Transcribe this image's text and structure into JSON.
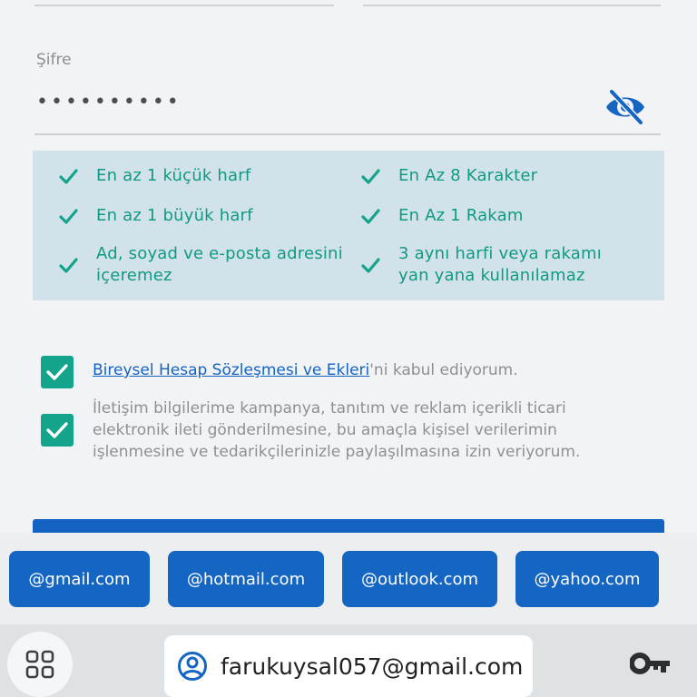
{
  "password": {
    "label": "Şifre",
    "value_masked": "••••••••••",
    "visibility_icon": "eye-off-icon"
  },
  "rules": [
    {
      "text": "En az 1 küçük harf"
    },
    {
      "text": "En Az 8 Karakter"
    },
    {
      "text": "En az 1 büyük harf"
    },
    {
      "text": "En Az 1 Rakam"
    },
    {
      "text": "Ad, soyad ve e-posta adresini içeremez"
    },
    {
      "text": "3 aynı harfi veya rakamı yan yana kullanılamaz"
    }
  ],
  "consents": {
    "agreement_link": "Bireysel Hesap Sözleşmesi ve Ekleri",
    "agreement_suffix": "'ni kabul ediyorum.",
    "marketing_text": "İletişim bilgilerime kampanya, tanıtım ve reklam içerikli ticari elektronik ileti gönderilmesine, bu amaçla kişisel verilerimin işlenmesine ve tedarikçilerinizle paylaşılmasına izin veriyorum."
  },
  "email_suggestions": [
    "@gmail.com",
    "@hotmail.com",
    "@outlook.com",
    "@yahoo.com"
  ],
  "keyboard_bar": {
    "autofill_email": "farukuysal057@gmail.com",
    "apps_icon": "grid-icon",
    "account_icon": "account-circle-icon",
    "password_manager_icon": "key-icon"
  },
  "colors": {
    "accent_green": "#13a48b",
    "primary_blue": "#1565c3",
    "rules_bg": "#d2e2ea"
  }
}
